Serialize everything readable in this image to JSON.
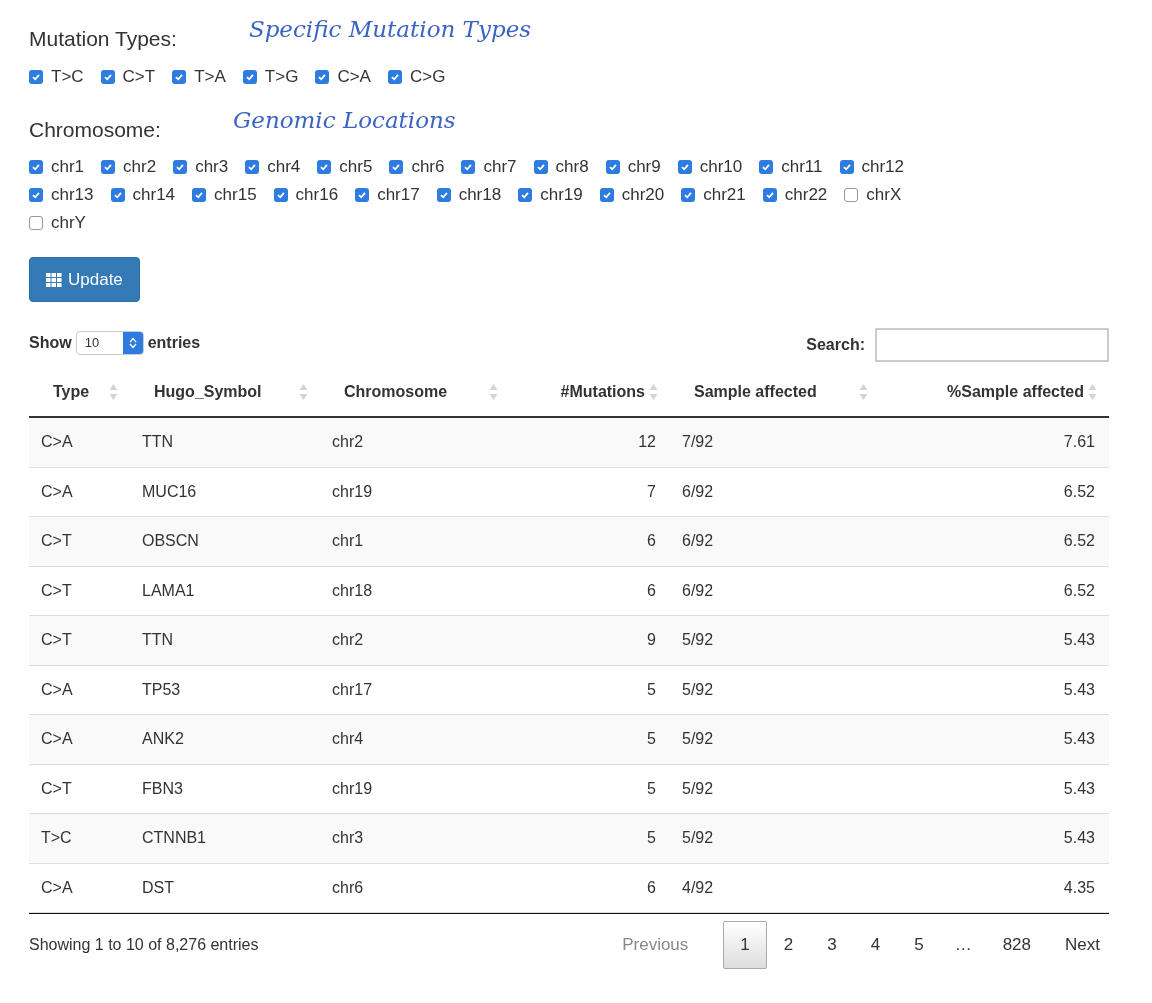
{
  "mutation_types": {
    "label": "Mutation Types:",
    "annotation": "Specific Mutation Types",
    "options": [
      {
        "label": "T>C",
        "checked": true
      },
      {
        "label": "C>T",
        "checked": true
      },
      {
        "label": "T>A",
        "checked": true
      },
      {
        "label": "T>G",
        "checked": true
      },
      {
        "label": "C>A",
        "checked": true
      },
      {
        "label": "C>G",
        "checked": true
      }
    ]
  },
  "chromosome": {
    "label": "Chromosome:",
    "annotation": "Genomic Locations",
    "options": [
      {
        "label": "chr1",
        "checked": true
      },
      {
        "label": "chr2",
        "checked": true
      },
      {
        "label": "chr3",
        "checked": true
      },
      {
        "label": "chr4",
        "checked": true
      },
      {
        "label": "chr5",
        "checked": true
      },
      {
        "label": "chr6",
        "checked": true
      },
      {
        "label": "chr7",
        "checked": true
      },
      {
        "label": "chr8",
        "checked": true
      },
      {
        "label": "chr9",
        "checked": true
      },
      {
        "label": "chr10",
        "checked": true
      },
      {
        "label": "chr11",
        "checked": true
      },
      {
        "label": "chr12",
        "checked": true
      },
      {
        "label": "chr13",
        "checked": true
      },
      {
        "label": "chr14",
        "checked": true
      },
      {
        "label": "chr15",
        "checked": true
      },
      {
        "label": "chr16",
        "checked": true
      },
      {
        "label": "chr17",
        "checked": true
      },
      {
        "label": "chr18",
        "checked": true
      },
      {
        "label": "chr19",
        "checked": true
      },
      {
        "label": "chr20",
        "checked": true
      },
      {
        "label": "chr21",
        "checked": true
      },
      {
        "label": "chr22",
        "checked": true
      },
      {
        "label": "chrX",
        "checked": false
      },
      {
        "label": "chrY",
        "checked": false
      }
    ]
  },
  "update_button": {
    "label": "Update"
  },
  "table_controls": {
    "show_label": "Show",
    "length": "10",
    "entries_label": "entries",
    "search_label": "Search:"
  },
  "table": {
    "columns": [
      {
        "label": "Type",
        "kind": "text"
      },
      {
        "label": "Hugo_Symbol",
        "kind": "text"
      },
      {
        "label": "Chromosome",
        "kind": "text"
      },
      {
        "label": "#Mutations",
        "kind": "number"
      },
      {
        "label": "Sample affected",
        "kind": "text"
      },
      {
        "label": "%Sample affected",
        "kind": "number"
      }
    ],
    "rows": [
      [
        "C>A",
        "TTN",
        "chr2",
        "12",
        "7/92",
        "7.61"
      ],
      [
        "C>A",
        "MUC16",
        "chr19",
        "7",
        "6/92",
        "6.52"
      ],
      [
        "C>T",
        "OBSCN",
        "chr1",
        "6",
        "6/92",
        "6.52"
      ],
      [
        "C>T",
        "LAMA1",
        "chr18",
        "6",
        "6/92",
        "6.52"
      ],
      [
        "C>T",
        "TTN",
        "chr2",
        "9",
        "5/92",
        "5.43"
      ],
      [
        "C>A",
        "TP53",
        "chr17",
        "5",
        "5/92",
        "5.43"
      ],
      [
        "C>A",
        "ANK2",
        "chr4",
        "5",
        "5/92",
        "5.43"
      ],
      [
        "C>T",
        "FBN3",
        "chr19",
        "5",
        "5/92",
        "5.43"
      ],
      [
        "T>C",
        "CTNNB1",
        "chr3",
        "5",
        "5/92",
        "5.43"
      ],
      [
        "C>A",
        "DST",
        "chr6",
        "6",
        "4/92",
        "4.35"
      ]
    ]
  },
  "info": "Showing 1 to 10 of 8,276 entries",
  "pagination": [
    {
      "label": "Previous",
      "kind": "nav",
      "disabled": true
    },
    {
      "label": "1",
      "kind": "page",
      "selected": true
    },
    {
      "label": "2",
      "kind": "page",
      "selected": false
    },
    {
      "label": "3",
      "kind": "page",
      "selected": false
    },
    {
      "label": "4",
      "kind": "page",
      "selected": false
    },
    {
      "label": "5",
      "kind": "page",
      "selected": false
    },
    {
      "label": "…",
      "kind": "ellipsis"
    },
    {
      "label": "828",
      "kind": "page",
      "selected": false
    },
    {
      "label": "Next",
      "kind": "nav",
      "disabled": false
    }
  ]
}
